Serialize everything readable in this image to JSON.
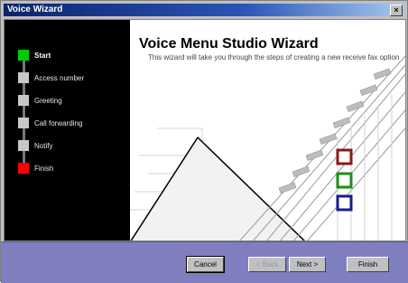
{
  "window": {
    "title": "Voice Wizard",
    "close_glyph": "×"
  },
  "sidebar": {
    "steps": [
      {
        "label": "Start",
        "color": "#00cc00"
      },
      {
        "label": "Access number",
        "color": "#c8c8c8"
      },
      {
        "label": "Greeting",
        "color": "#c8c8c8"
      },
      {
        "label": "Call forwarding",
        "color": "#c8c8c8"
      },
      {
        "label": "Notify",
        "color": "#c8c8c8"
      },
      {
        "label": "Finish",
        "color": "#ff0000"
      }
    ],
    "active_index": 0
  },
  "main": {
    "heading": "Voice Menu Studio Wizard",
    "description": "This wizard will take you through the steps of creating a new receive fax option"
  },
  "decor": {
    "square_colors": [
      "#8b1a1a",
      "#1a8f1a",
      "#1a1a8f"
    ]
  },
  "buttons": {
    "cancel": "Cancel",
    "back": "< Back",
    "next": "Next >",
    "finish": "Finish"
  }
}
